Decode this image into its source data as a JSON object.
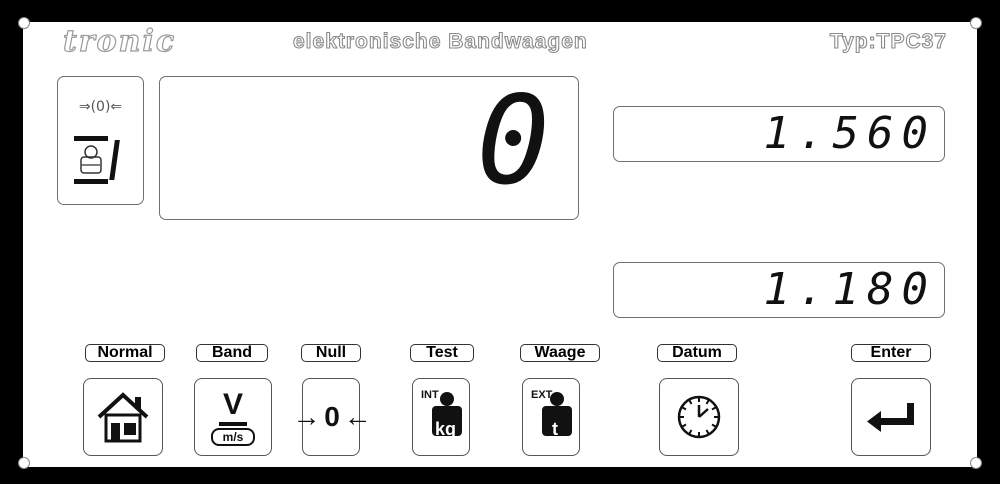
{
  "header": {
    "brand": "tronic",
    "subtitle": "elektronische Bandwaagen",
    "type": "Typ:TPC37"
  },
  "displays": {
    "main": "0",
    "upper_right": "1.560",
    "lower_right": "1.180"
  },
  "zero_indicator": {
    "symbol": "⇒(0)⇐"
  },
  "keys": [
    {
      "label": "Normal",
      "icon": "home-icon"
    },
    {
      "label": "Band",
      "icon": "belt-speed-icon",
      "icon_text_big": "V",
      "icon_text_small": "m/s"
    },
    {
      "label": "Null",
      "icon": "zero-icon",
      "icon_text": "→ 0 ←"
    },
    {
      "label": "Test",
      "icon": "weight-int-icon",
      "icon_text_top": "INT",
      "icon_text": "kg"
    },
    {
      "label": "Waage",
      "icon": "weight-ext-icon",
      "icon_text_top": "EXT",
      "icon_text": "t"
    },
    {
      "label": "Datum",
      "icon": "clock-icon"
    },
    {
      "label": "Enter",
      "icon": "enter-icon"
    }
  ],
  "colors": {
    "frame": "#000000",
    "panel": "#ffffff",
    "digits": "#111111",
    "outline_text": "#8a8a8a"
  }
}
